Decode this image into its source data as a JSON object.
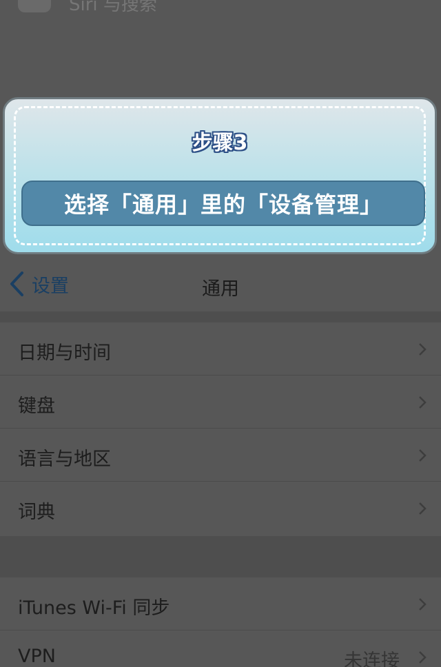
{
  "faded_top": {
    "text": "Siri 与搜索"
  },
  "step": {
    "title": "步骤3",
    "instruction": "选择「通用」里的「设备管理」"
  },
  "nav": {
    "back_label": "设置",
    "title": "通用"
  },
  "group1": [
    {
      "label": "日期与时间"
    },
    {
      "label": "键盘"
    },
    {
      "label": "语言与地区"
    },
    {
      "label": "词典"
    }
  ],
  "group2": [
    {
      "label": "iTunes Wi-Fi 同步"
    },
    {
      "label": "VPN",
      "value": "未连接"
    }
  ],
  "colors": {
    "accent": "#1a3f63",
    "overlay": "#575757",
    "card_pill": "#5288a8"
  }
}
